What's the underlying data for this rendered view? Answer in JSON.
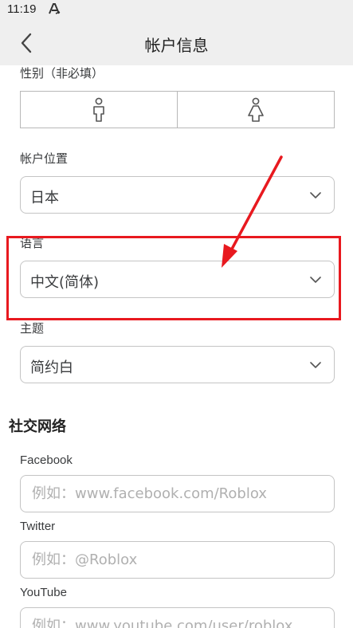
{
  "status_bar": {
    "time": "11:19",
    "icon": "a-letter-icon"
  },
  "header": {
    "title": "帐户信息",
    "back_icon": "chevron-left-icon"
  },
  "gender": {
    "label": "性别（非必填）",
    "options": [
      "male-icon",
      "female-icon"
    ]
  },
  "location": {
    "label": "帐户位置",
    "value": "日本"
  },
  "language": {
    "label": "语言",
    "value": "中文(简体)"
  },
  "theme": {
    "label": "主题",
    "value": "简约白"
  },
  "social": {
    "title": "社交网络",
    "fields": [
      {
        "label": "Facebook",
        "placeholder": "例如：www.facebook.com/Roblox"
      },
      {
        "label": "Twitter",
        "placeholder": "例如：@Roblox"
      },
      {
        "label": "YouTube",
        "placeholder": "例如：www.youtube.com/user/roblox"
      }
    ]
  },
  "annotation": {
    "color": "#e8191f"
  }
}
